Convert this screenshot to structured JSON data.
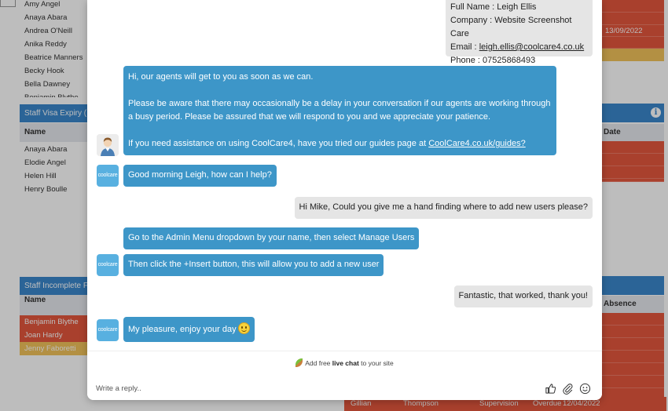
{
  "background": {
    "staff_list_top": [
      "Amy Angel",
      "Anaya Abara",
      "Andrea O'Neill",
      "Anika Reddy",
      "Beatrice Manners",
      "Becky Hook",
      "Bella Dawney",
      "Benjamin Blythe"
    ],
    "visa_panel": {
      "title": "Staff Visa Expiry (",
      "name_header": "Name",
      "date_header": "Date",
      "names": [
        "Anaya Abara",
        "Elodie Angel",
        "Helen Hill",
        "Henry Boulle"
      ]
    },
    "incomplete_panel": {
      "title": "Staff Incomplete F",
      "name_header": "Name",
      "absence_header": "Absence",
      "rows": [
        {
          "name": "Benjamin Blythe",
          "color": "#e4573d"
        },
        {
          "name": "Joan Hardy",
          "color": "#e4573d"
        },
        {
          "name": "Jenny Faboretti",
          "color": "#f2c35b"
        }
      ]
    },
    "right_date": "13/09/2022",
    "bottom_row": [
      "Gillian",
      "Thompson",
      "Supervision",
      "Overdue",
      "12/04/2022"
    ],
    "colors": {
      "red": "#e4573d",
      "yellow": "#f2c35b",
      "blue": "#3a87cc"
    }
  },
  "chat": {
    "visitor_info": {
      "full_name": "Full Name : Leigh Ellis",
      "company": "Company : Website Screenshot Care",
      "email_label": "Email : ",
      "email": "leigh.ellis@coolcare4.co.uk",
      "phone": "Phone : 07525868493"
    },
    "auto_message": {
      "line1": "Hi, our agents will get to you as soon as we can.",
      "line2": "Please be aware that there may occasionally be a delay in your conversation if our agents are working through a busy period. Please be assured that we will respond to you and we appreciate your patience.",
      "line3_prefix": "If you need assistance on using CoolCare4, have you tried our guides page at ",
      "line3_link": "CoolCare4.co.uk/guides?"
    },
    "messages": [
      {
        "from": "agent",
        "text": "Good morning Leigh, how can I help?"
      },
      {
        "from": "visitor",
        "text": "Hi Mike, Could you give me a hand finding where to add new users please?"
      },
      {
        "from": "agent",
        "text": "Go to the Admin Menu dropdown by your name, then select Manage Users"
      },
      {
        "from": "agent",
        "text": "Then click the +Insert button, this will allow you to add a new user"
      },
      {
        "from": "visitor",
        "text": "Fantastic, that worked, thank you!"
      },
      {
        "from": "agent",
        "text": "My pleasure, enjoy your day"
      }
    ],
    "avatar_logo_text": "coolcare",
    "footer": {
      "powered_prefix": "Add free ",
      "powered_bold": "live chat",
      "powered_suffix": " to your site",
      "reply_placeholder": "Write a reply.."
    },
    "icons": [
      "thumbs-up-icon",
      "paperclip-icon",
      "smiley-icon"
    ],
    "colors": {
      "agent_bubble": "#3d96c8",
      "visitor_bubble": "#e5e5e5"
    }
  }
}
